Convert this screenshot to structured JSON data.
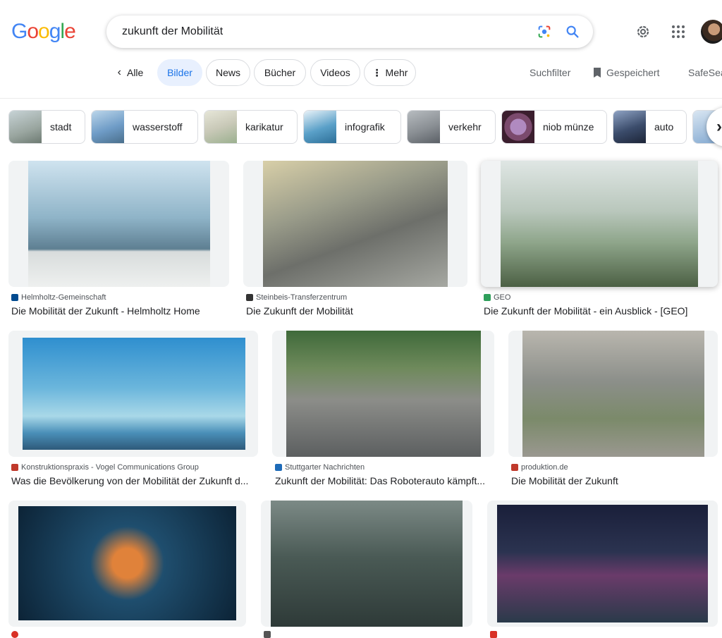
{
  "header": {
    "logo_letters": [
      "G",
      "o",
      "o",
      "g",
      "l",
      "e"
    ],
    "logo_colors": [
      "#4285F4",
      "#EA4335",
      "#FBBC05",
      "#4285F4",
      "#34A853",
      "#EA4335"
    ],
    "search_value": "zukunft der Mobilität"
  },
  "tabs": {
    "back_label": "Alle",
    "items": [
      "Bilder",
      "News",
      "Bücher",
      "Videos",
      "Mehr"
    ],
    "active": "Bilder",
    "suchfilter": "Suchfilter",
    "gespeichert": "Gespeichert",
    "safesearch": "SafeSea"
  },
  "chips": [
    {
      "label": "stadt",
      "color": "#9aa6a0"
    },
    {
      "label": "wasserstoff",
      "color": "#6f9cc7"
    },
    {
      "label": "karikatur",
      "color": "#c9c9b8"
    },
    {
      "label": "infografik",
      "color": "#5aa0c8"
    },
    {
      "label": "verkehr",
      "color": "#8a8f94"
    },
    {
      "label": "niob münze",
      "color": "#7b4a6d"
    },
    {
      "label": "auto",
      "color": "#3b4c6b"
    }
  ],
  "results": [
    {
      "source": "Helmholtz-Gemeinschaft",
      "title": "Die Mobilität der Zukunft - Helmholtz Home",
      "fav_color": "#004a8f",
      "img_color": "#8fb4c8"
    },
    {
      "source": "Steinbeis-Transferzentrum",
      "title": "Die Zukunft der Mobilität",
      "fav_color": "#333333",
      "img_color": "#9a9c8a"
    },
    {
      "source": "GEO",
      "title": "Die Zukunft der Mobilität - ein Ausblick - [GEO]",
      "fav_color": "#2e9e5a",
      "img_color": "#8ea58a"
    },
    {
      "source": "Konstruktionspraxis - Vogel Communications Group",
      "title": "Was die Bevölkerung von der Mobilität der Zukunft d...",
      "fav_color": "#c0392b",
      "img_color": "#6bb6dc"
    },
    {
      "source": "Stuttgarter Nachrichten",
      "title": "Zukunft der Mobilität: Das Roboterauto kämpft...",
      "fav_color": "#1e6bb8",
      "img_color": "#6f8a5c"
    },
    {
      "source": "produktion.de",
      "title": "Die Mobilität der Zukunft",
      "fav_color": "#c0392b",
      "img_color": "#8c8f8a"
    },
    {
      "source": "",
      "title": "",
      "fav_color": "#d93025",
      "img_color": "#1f4e6e"
    },
    {
      "source": "",
      "title": "",
      "fav_color": "#555555",
      "img_color": "#4a5a55"
    },
    {
      "source": "",
      "title": "",
      "fav_color": "#d93025",
      "img_color": "#2b3350"
    }
  ]
}
